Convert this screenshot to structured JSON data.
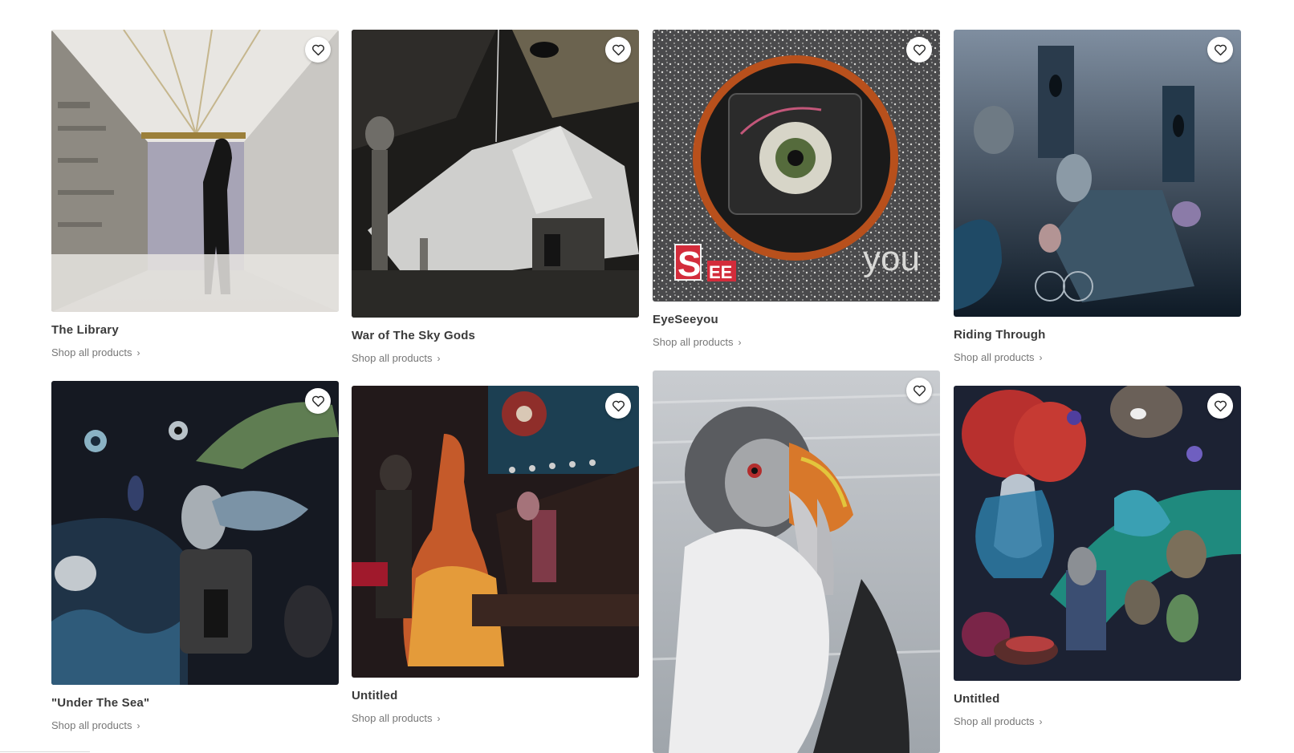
{
  "gallery": {
    "items": [
      {
        "title": "The Library",
        "link": "Shop all products",
        "chevron": "›",
        "favorite_icon": "heart-outline-icon"
      },
      {
        "title": "War of The Sky Gods",
        "link": "Shop all products",
        "chevron": "›",
        "favorite_icon": "heart-outline-icon"
      },
      {
        "title": "EyeSeeyou",
        "link": "Shop all products",
        "chevron": "›",
        "favorite_icon": "heart-outline-icon",
        "art_text": {
          "s": "S",
          "ee": "EE",
          "you": "you"
        }
      },
      {
        "title": "Riding Through",
        "link": "Shop all products",
        "chevron": "›",
        "favorite_icon": "heart-outline-icon"
      },
      {
        "title": "\"Under The Sea\"",
        "link": "Shop all products",
        "chevron": "›",
        "favorite_icon": "heart-outline-icon"
      },
      {
        "title": "Untitled",
        "link": "Shop all products",
        "chevron": "›",
        "favorite_icon": "heart-outline-icon"
      },
      {
        "title": "",
        "link": "",
        "chevron": "",
        "favorite_icon": "heart-outline-icon"
      },
      {
        "title": "Untitled",
        "link": "Shop all products",
        "chevron": "›",
        "favorite_icon": "heart-outline-icon"
      }
    ]
  }
}
